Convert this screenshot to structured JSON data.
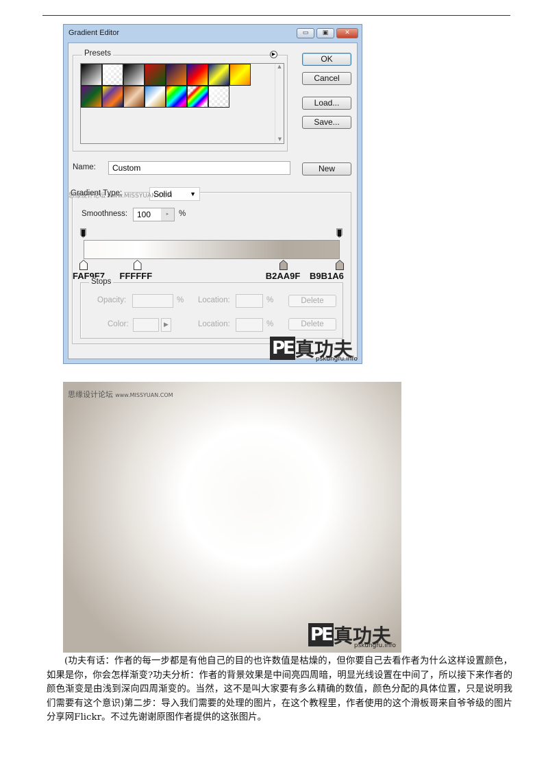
{
  "dialog": {
    "title": "Gradient Editor",
    "presets_label": "Presets",
    "buttons": {
      "ok": "OK",
      "cancel": "Cancel",
      "load": "Load...",
      "save": "Save...",
      "new": "New"
    },
    "name_label": "Name:",
    "name_value": "Custom",
    "gradient_type_label": "Gradient Type:",
    "gradient_type_value": "Solid",
    "smoothness_label": "Smoothness:",
    "smoothness_value": "100",
    "percent": "%",
    "stops": {
      "label": "Stops",
      "opacity_label": "Opacity:",
      "color_label": "Color:",
      "location_label": "Location:",
      "delete_label": "Delete"
    },
    "color_stops": [
      {
        "hex": "FAF9F7",
        "location": 0
      },
      {
        "hex": "FFFFFF",
        "location": 21
      },
      {
        "hex": "B2AA9F",
        "location": 78
      },
      {
        "hex": "B9B1A6",
        "location": 100
      }
    ],
    "presets": [
      "#000000,#ffffff",
      "transparent",
      "#000000,#ffffff",
      "#d01010,#0a5a10",
      "#1a1060,#ff8000",
      "#1010a0,#ff0000,#ffff00",
      "#0a1a90,#ffff20,#0a1a90",
      "#ff8000,#ffff00,#ff8000",
      "#6a0a80,#0a6020,#ff8000",
      "#ffee00,#6a3aa0,#ff7a10,#002080",
      "#8a4010,#f0d0b0,#8a4010",
      "#4090e0,#ffffff,#c09020",
      "#ff0000,#ffff00,#00ff00,#00ffff,#0000ff,#ff00ff,#ff0000",
      "transparent-rainbow",
      "transparent-stripes"
    ]
  },
  "watermark": {
    "text": "思缘设计论坛",
    "url": "www.MISSYUAN.COM"
  },
  "logo": {
    "pe": "PE",
    "cn": "真功夫",
    "url": "pskungfu.info"
  },
  "paragraph": "(功夫有话：作者的每一步都是有他自己的目的也许数值是枯燥的，但你要自己去看作者为什么这样设置颜色，如果是你，你会怎样渐变?功夫分析：作者的背景效果是中间亮四周暗，明显光线设置在中间了，所以接下来作者的颜色渐变是由浅到深向四周渐变的。当然，这不是叫大家要有多么精确的数值，颜色分配的具体位置，只是说明我们需要有这个意识)第二步：导入我们需要的处理的图片，在这个教程里，作者使用的这个滑板哥来自爷爷级的图片分享网Flickr。不过先谢谢原图作者提供的这张图片。"
}
